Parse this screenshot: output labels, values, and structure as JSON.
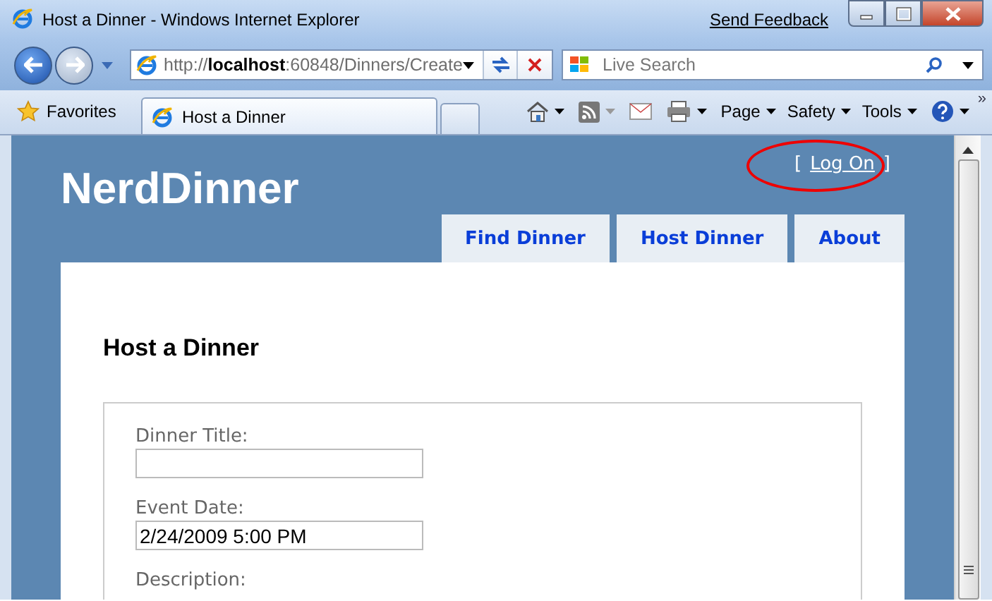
{
  "window": {
    "title": "Host a Dinner - Windows Internet Explorer",
    "feedback_link": "Send Feedback"
  },
  "address_bar": {
    "url": "http://**localhost**:60848/Dinners/Create"
  },
  "search": {
    "placeholder": "Live Search"
  },
  "favorites": {
    "label": "Favorites"
  },
  "tabs": [
    {
      "label": "Host a Dinner",
      "selected": true
    }
  ],
  "commands": [
    {
      "label": "Page"
    },
    {
      "label": "Safety"
    },
    {
      "label": "Tools"
    }
  ],
  "overflow": "»",
  "site": {
    "title": "NerdDinner",
    "login": {
      "open": "[",
      "link": "Log On",
      "close": "]"
    },
    "menu": [
      {
        "label": "Find Dinner"
      },
      {
        "label": "Host Dinner"
      },
      {
        "label": "About"
      }
    ],
    "heading": "Host a Dinner",
    "fields": [
      {
        "label": "Dinner Title:"
      },
      {
        "label": "Event Date:",
        "value": "2/24/2009 5:00 PM"
      },
      {
        "label": "Description:"
      }
    ]
  }
}
